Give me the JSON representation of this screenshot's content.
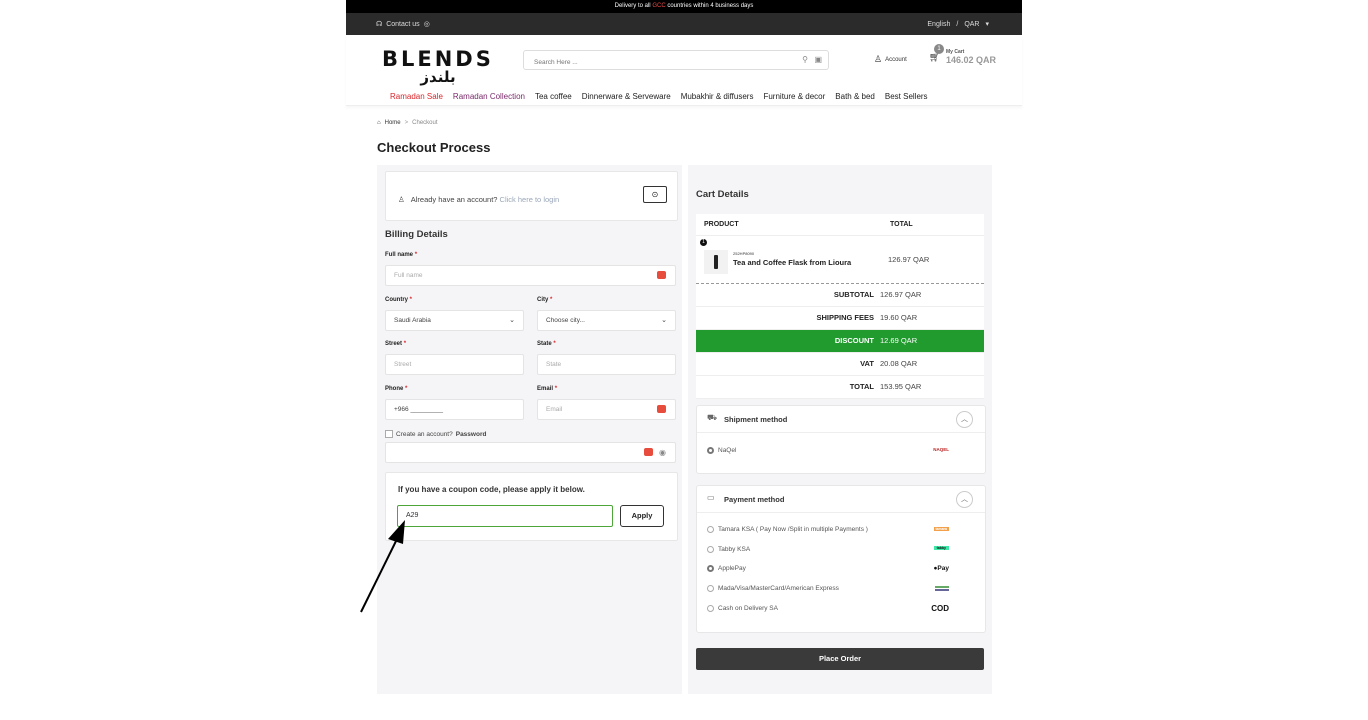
{
  "topbar": {
    "pre": "Delivery to all ",
    "highlight": "GCC",
    "post": " countries within 4 business days"
  },
  "subbar": {
    "contact": "Contact us",
    "language": "English",
    "separator": "/",
    "currency": "QAR"
  },
  "logo": {
    "en": "BLENDS",
    "ar": "بلندز"
  },
  "search": {
    "placeholder": "Search Here ..."
  },
  "account": {
    "label": "Account"
  },
  "cart": {
    "count": "1",
    "label": "My Cart",
    "amount": "146.02 QAR"
  },
  "nav": [
    "Ramadan Sale",
    "Ramadan Collection",
    "Tea coffee",
    "Dinnerware & Serveware",
    "Mubakhir & diffusers",
    "Furniture & decor",
    "Bath & bed",
    "Best Sellers"
  ],
  "breadcrumb": {
    "home": "Home",
    "sep": ">",
    "current": "Checkout"
  },
  "page_title": "Checkout Process",
  "login": {
    "text": "Already have an account? ",
    "link": "Click here to login"
  },
  "billing": {
    "title": "Billing Details",
    "full_name": {
      "label": "Full name",
      "placeholder": "Full name"
    },
    "country": {
      "label": "Country",
      "value": "Saudi Arabia"
    },
    "city": {
      "label": "City",
      "value": "Choose city..."
    },
    "street": {
      "label": "Street",
      "placeholder": "Street"
    },
    "state": {
      "label": "State",
      "placeholder": "State"
    },
    "phone": {
      "label": "Phone",
      "value": "+966 _________"
    },
    "email": {
      "label": "Email",
      "placeholder": "Email"
    },
    "create_account": "Create an account? ",
    "password_label": "Password",
    "required_mark": "*"
  },
  "coupon": {
    "title": "If you have a coupon code, please apply it below.",
    "value": "A29",
    "apply": "Apply"
  },
  "cart_details": {
    "title": "Cart Details",
    "col_product": "PRODUCT",
    "col_total": "TOTAL",
    "item": {
      "qty": "1",
      "sku": "252HP8090",
      "name": "Tea and Coffee Flask from Lioura",
      "total": "126.97 QAR"
    },
    "subtotal": {
      "label": "SUBTOTAL",
      "value": "126.97 QAR"
    },
    "shipping": {
      "label": "SHIPPING FEES",
      "value": "19.60 QAR"
    },
    "discount": {
      "label": "DISCOUNT",
      "value": "12.69 QAR"
    },
    "vat": {
      "label": "VAT",
      "value": "20.08 QAR"
    },
    "total": {
      "label": "TOTAL",
      "value": "153.95 QAR"
    }
  },
  "shipment": {
    "title": "Shipment method",
    "option": "NaQel",
    "brand": "NAQEL"
  },
  "payment": {
    "title": "Payment method",
    "options": [
      {
        "label": "Tamara KSA ( Pay Now /Split in multiple Payments )",
        "brand": "tamara"
      },
      {
        "label": "Tabby KSA",
        "brand": "tabby"
      },
      {
        "label": "ApplePay",
        "brand": "Pay"
      },
      {
        "label": "Mada/Visa/MasterCard/American Express",
        "brand": "cards"
      },
      {
        "label": "Cash on Delivery SA",
        "brand": "COD"
      }
    ]
  },
  "place_order": "Place Order"
}
